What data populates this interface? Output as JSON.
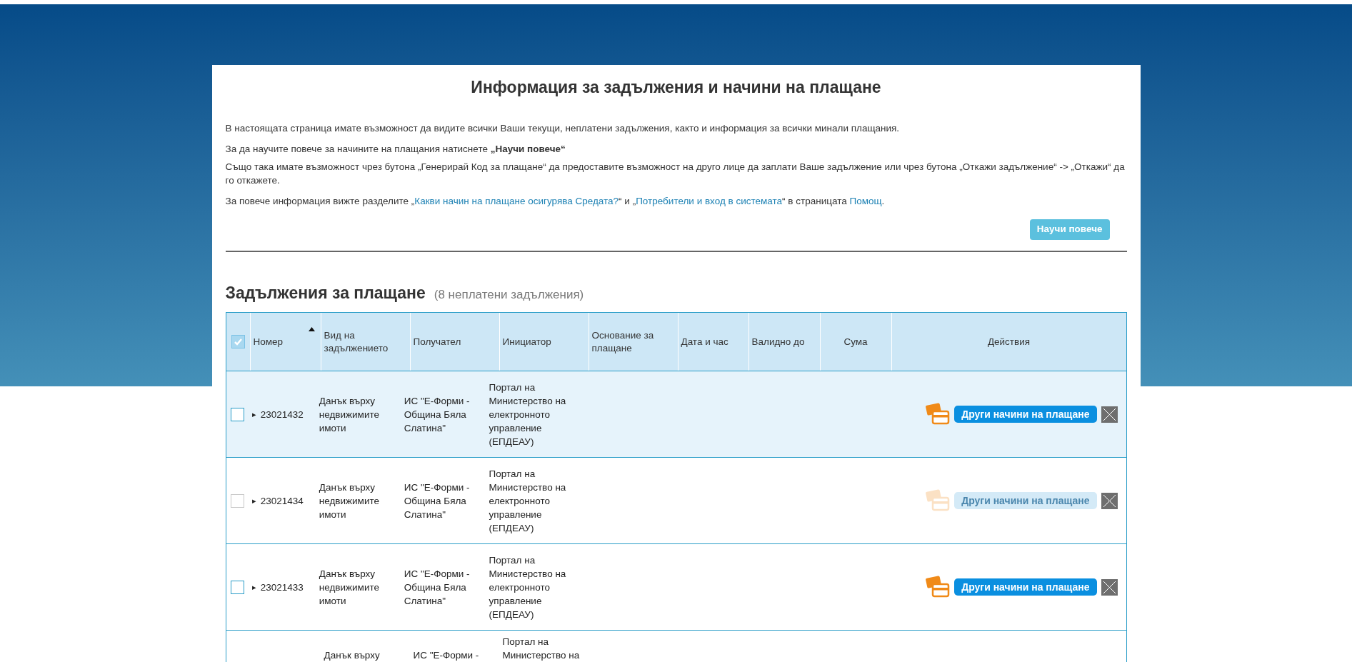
{
  "title": "Информация за задължения и начини на плащане",
  "intro": [
    {
      "kind": "plain",
      "text": "В настоящата страница имате възможност да видите всички Ваши текущи, неплатени задължения, както и информация за всички минали плащания."
    },
    {
      "kind": "plain",
      "text": "За да научите повече за начините на плащания натиснете **„Научи повече“**"
    },
    {
      "kind": "plain",
      "text": "Също така имате възможност чрез бутона „Генерирай Код за плащане“ да предоставите възможност на друго лице да заплати Ваше задължение или чрез бутона „Откажи задължение“ -> „Откажи“ да го откажете."
    },
    {
      "kind": "links",
      "parts": [
        {
          "text": "За повече информация вижте разделите „",
          "link": false
        },
        {
          "text": "Какви начин на плащане осигурява Средата?",
          "link": true
        },
        {
          "text": "“ и „",
          "link": false
        },
        {
          "text": "Потребители и вход в системата",
          "link": true
        },
        {
          "text": "“ в страницата ",
          "link": false
        },
        {
          "text": "Помощ",
          "link": true
        },
        {
          "text": ".",
          "link": false
        }
      ]
    }
  ],
  "learn_more_button": "Научи повече",
  "section": {
    "title": "Задължения за плащане",
    "count": "(8 неплатени задължения)"
  },
  "table": {
    "select_all": {
      "checked": true
    },
    "columns": [
      {
        "label": "Номер",
        "sorted": true
      },
      {
        "label": "Вид на задължението",
        "sorted": false
      },
      {
        "label": "Получател",
        "sorted": false
      },
      {
        "label": "Инициатор",
        "sorted": false
      },
      {
        "label": "Основание за плащане",
        "sorted": false
      },
      {
        "label": "Дата и час",
        "sorted": false
      },
      {
        "label": "Валидно до",
        "sorted": false
      },
      {
        "label": "Сума",
        "sorted": false
      },
      {
        "label": "Действия",
        "sorted": false
      }
    ],
    "rows": [
      {
        "checked": false,
        "disabled": false,
        "highlighted": true,
        "expand": "▸",
        "number": "23021432",
        "type": "Данък върху недвижимите имоти",
        "recipient": "ИС \"Е-Форми - Община Бяла Слатина\"",
        "initiator": "Портал на Министерство на електронното управление (ЕПДЕАУ)",
        "pay_button": {
          "label": "Други начини на плащане",
          "disabled": false
        }
      },
      {
        "checked": false,
        "disabled": true,
        "highlighted": false,
        "expand": "▸",
        "number": "23021434",
        "type": "Данък върху недвижимите имоти",
        "recipient": "ИС \"Е-Форми - Община Бяла Слатина\"",
        "initiator": "Портал на Министерство на електронното управление (ЕПДЕАУ)",
        "pay_button": {
          "label": "Други начини на плащане",
          "disabled": true
        }
      },
      {
        "checked": false,
        "disabled": false,
        "highlighted": false,
        "expand": "▸",
        "number": "23021433",
        "type": "Данък върху недвижимите имоти",
        "recipient": "ИС \"Е-Форми - Община Бяла Слатина\"",
        "initiator": "Портал на Министерство на електронното управление (ЕПДЕАУ)",
        "pay_button": {
          "label": "Други начини на плащане",
          "disabled": false
        }
      }
    ],
    "partial_row": {
      "type": "Данък върху",
      "recipient": "ИС \"Е-Форми -",
      "initiator": "Портал на Министерство на"
    }
  }
}
